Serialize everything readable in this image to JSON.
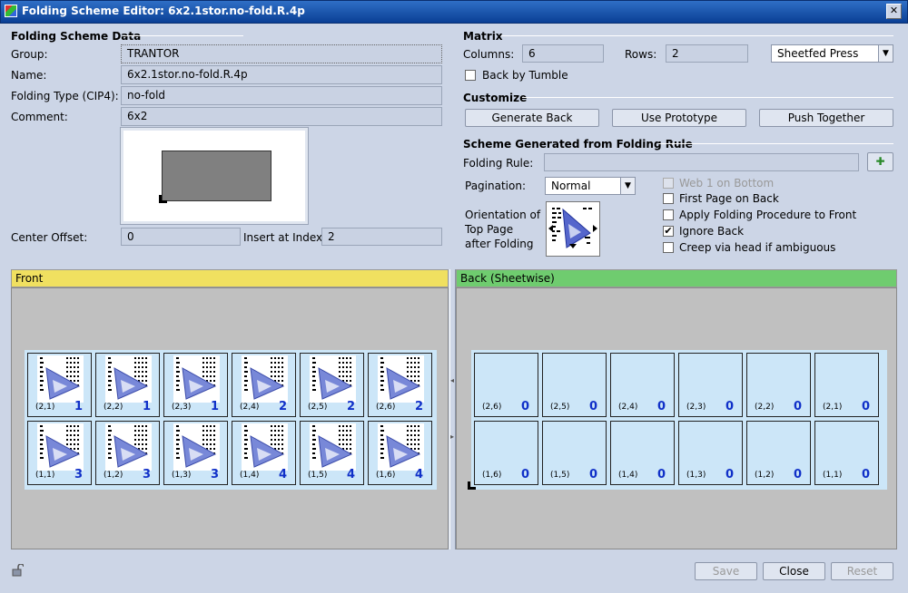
{
  "window": {
    "title": "Folding Scheme Editor: 6x2.1stor.no-fold.R.4p",
    "close_label": "✕"
  },
  "left": {
    "section_title": "Folding Scheme Data",
    "group_label": "Group:",
    "group_value": "TRANTOR",
    "name_label": "Name:",
    "name_value": "6x2.1stor.no-fold.R.4p",
    "folding_type_label": "Folding Type (CIP4):",
    "folding_type_value": "no-fold",
    "comment_label": "Comment:",
    "comment_value": "6x2",
    "center_offset_label": "Center Offset:",
    "center_offset_value": "0",
    "insert_label": "Insert at Index",
    "insert_value": "2"
  },
  "matrix": {
    "section_title": "Matrix",
    "columns_label": "Columns:",
    "columns_value": "6",
    "rows_label": "Rows:",
    "rows_value": "2",
    "press_value": "Sheetfed Press",
    "back_by_tumble_label": "Back by Tumble",
    "back_by_tumble_checked": false
  },
  "customize": {
    "section_title": "Customize",
    "generate_back": "Generate Back",
    "use_prototype": "Use Prototype",
    "push_together": "Push Together"
  },
  "scheme": {
    "section_title": "Scheme Generated from Folding Rule",
    "folding_rule_label": "Folding Rule:",
    "folding_rule_value": "",
    "pagination_label": "Pagination:",
    "pagination_value": "Normal",
    "orientation_label_1": "Orientation of",
    "orientation_label_2": "Top Page",
    "orientation_label_3": "after Folding",
    "options": [
      {
        "label": "Web 1 on Bottom",
        "checked": false,
        "disabled": true
      },
      {
        "label": "First Page on Back",
        "checked": false,
        "disabled": false
      },
      {
        "label": "Apply Folding Procedure to Front",
        "checked": false,
        "disabled": false
      },
      {
        "label": "Ignore Back",
        "checked": true,
        "disabled": false
      },
      {
        "label": "Creep via head if ambiguous",
        "checked": false,
        "disabled": false
      }
    ]
  },
  "front": {
    "title": "Front",
    "header_color": "#f0e060",
    "cells": [
      [
        {
          "coord": "(2,1)",
          "num": "1"
        },
        {
          "coord": "(2,2)",
          "num": "1"
        },
        {
          "coord": "(2,3)",
          "num": "1"
        },
        {
          "coord": "(2,4)",
          "num": "2"
        },
        {
          "coord": "(2,5)",
          "num": "2"
        },
        {
          "coord": "(2,6)",
          "num": "2"
        }
      ],
      [
        {
          "coord": "(1,1)",
          "num": "3"
        },
        {
          "coord": "(1,2)",
          "num": "3"
        },
        {
          "coord": "(1,3)",
          "num": "3"
        },
        {
          "coord": "(1,4)",
          "num": "4"
        },
        {
          "coord": "(1,5)",
          "num": "4"
        },
        {
          "coord": "(1,6)",
          "num": "4"
        }
      ]
    ]
  },
  "back": {
    "title": "Back (Sheetwise)",
    "header_color": "#6fcc6f",
    "cells": [
      [
        {
          "coord": "(2,6)",
          "num": "0"
        },
        {
          "coord": "(2,5)",
          "num": "0"
        },
        {
          "coord": "(2,4)",
          "num": "0"
        },
        {
          "coord": "(2,3)",
          "num": "0"
        },
        {
          "coord": "(2,2)",
          "num": "0"
        },
        {
          "coord": "(2,1)",
          "num": "0"
        }
      ],
      [
        {
          "coord": "(1,6)",
          "num": "0"
        },
        {
          "coord": "(1,5)",
          "num": "0"
        },
        {
          "coord": "(1,4)",
          "num": "0"
        },
        {
          "coord": "(1,3)",
          "num": "0"
        },
        {
          "coord": "(1,2)",
          "num": "0"
        },
        {
          "coord": "(1,1)",
          "num": "0"
        }
      ]
    ]
  },
  "footer": {
    "save": "Save",
    "close": "Close",
    "reset": "Reset"
  }
}
